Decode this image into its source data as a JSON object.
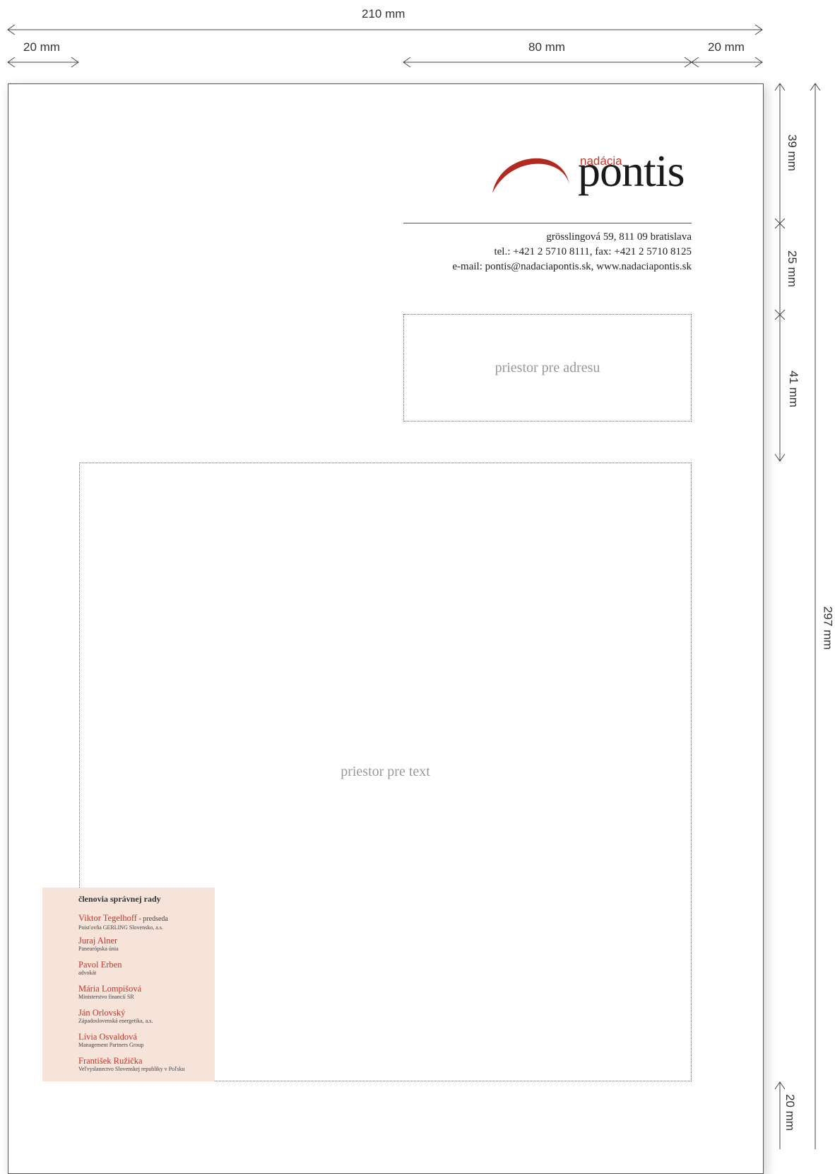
{
  "dimensions": {
    "page_width": "210 mm",
    "left_margin": "20 mm",
    "header_width": "80 mm",
    "right_margin": "20 mm",
    "logo_height": "39 mm",
    "address_height": "25 mm",
    "recipient_height": "41 mm",
    "page_height": "297 mm",
    "bottom_margin": "20 mm"
  },
  "logo": {
    "small": "nadácia",
    "big": "pontis",
    "arc_color": "#b22a1f"
  },
  "address": {
    "line1": "grösslingová 59, 811 09 bratislava",
    "line2": "tel.: +421 2 5710 8111, fax: +421 2 5710 8125",
    "line3": "e-mail: pontis@nadaciapontis.sk, www.nadaciapontis.sk"
  },
  "placeholders": {
    "address": "priestor pre adresu",
    "text": "priestor pre text"
  },
  "board": {
    "title": "členovia správnej rady",
    "members": [
      {
        "name": "Viktor Tegelhoff",
        "role": " - predseda",
        "org": "Poisťovňa GERLING Slovensko, a.s."
      },
      {
        "name": "Juraj Alner",
        "role": "",
        "org": "Paneurópska únia"
      },
      {
        "name": "Pavol Erben",
        "role": "",
        "org": "advokát"
      },
      {
        "name": "Mária Lompišová",
        "role": "",
        "org": "Ministerstvo financií SR"
      },
      {
        "name": "Ján Orlovský",
        "role": "",
        "org": "Západoslovenská energetika, a.s."
      },
      {
        "name": "Lívia Osvaldová",
        "role": "",
        "org": "Management Partners Group"
      },
      {
        "name": "František Ružička",
        "role": "",
        "org": "Veľvyslanectvo Slovenskej republiky v Poľsku"
      }
    ]
  },
  "colors": {
    "accent": "#c0392b",
    "board_bg": "#f6e3da"
  }
}
